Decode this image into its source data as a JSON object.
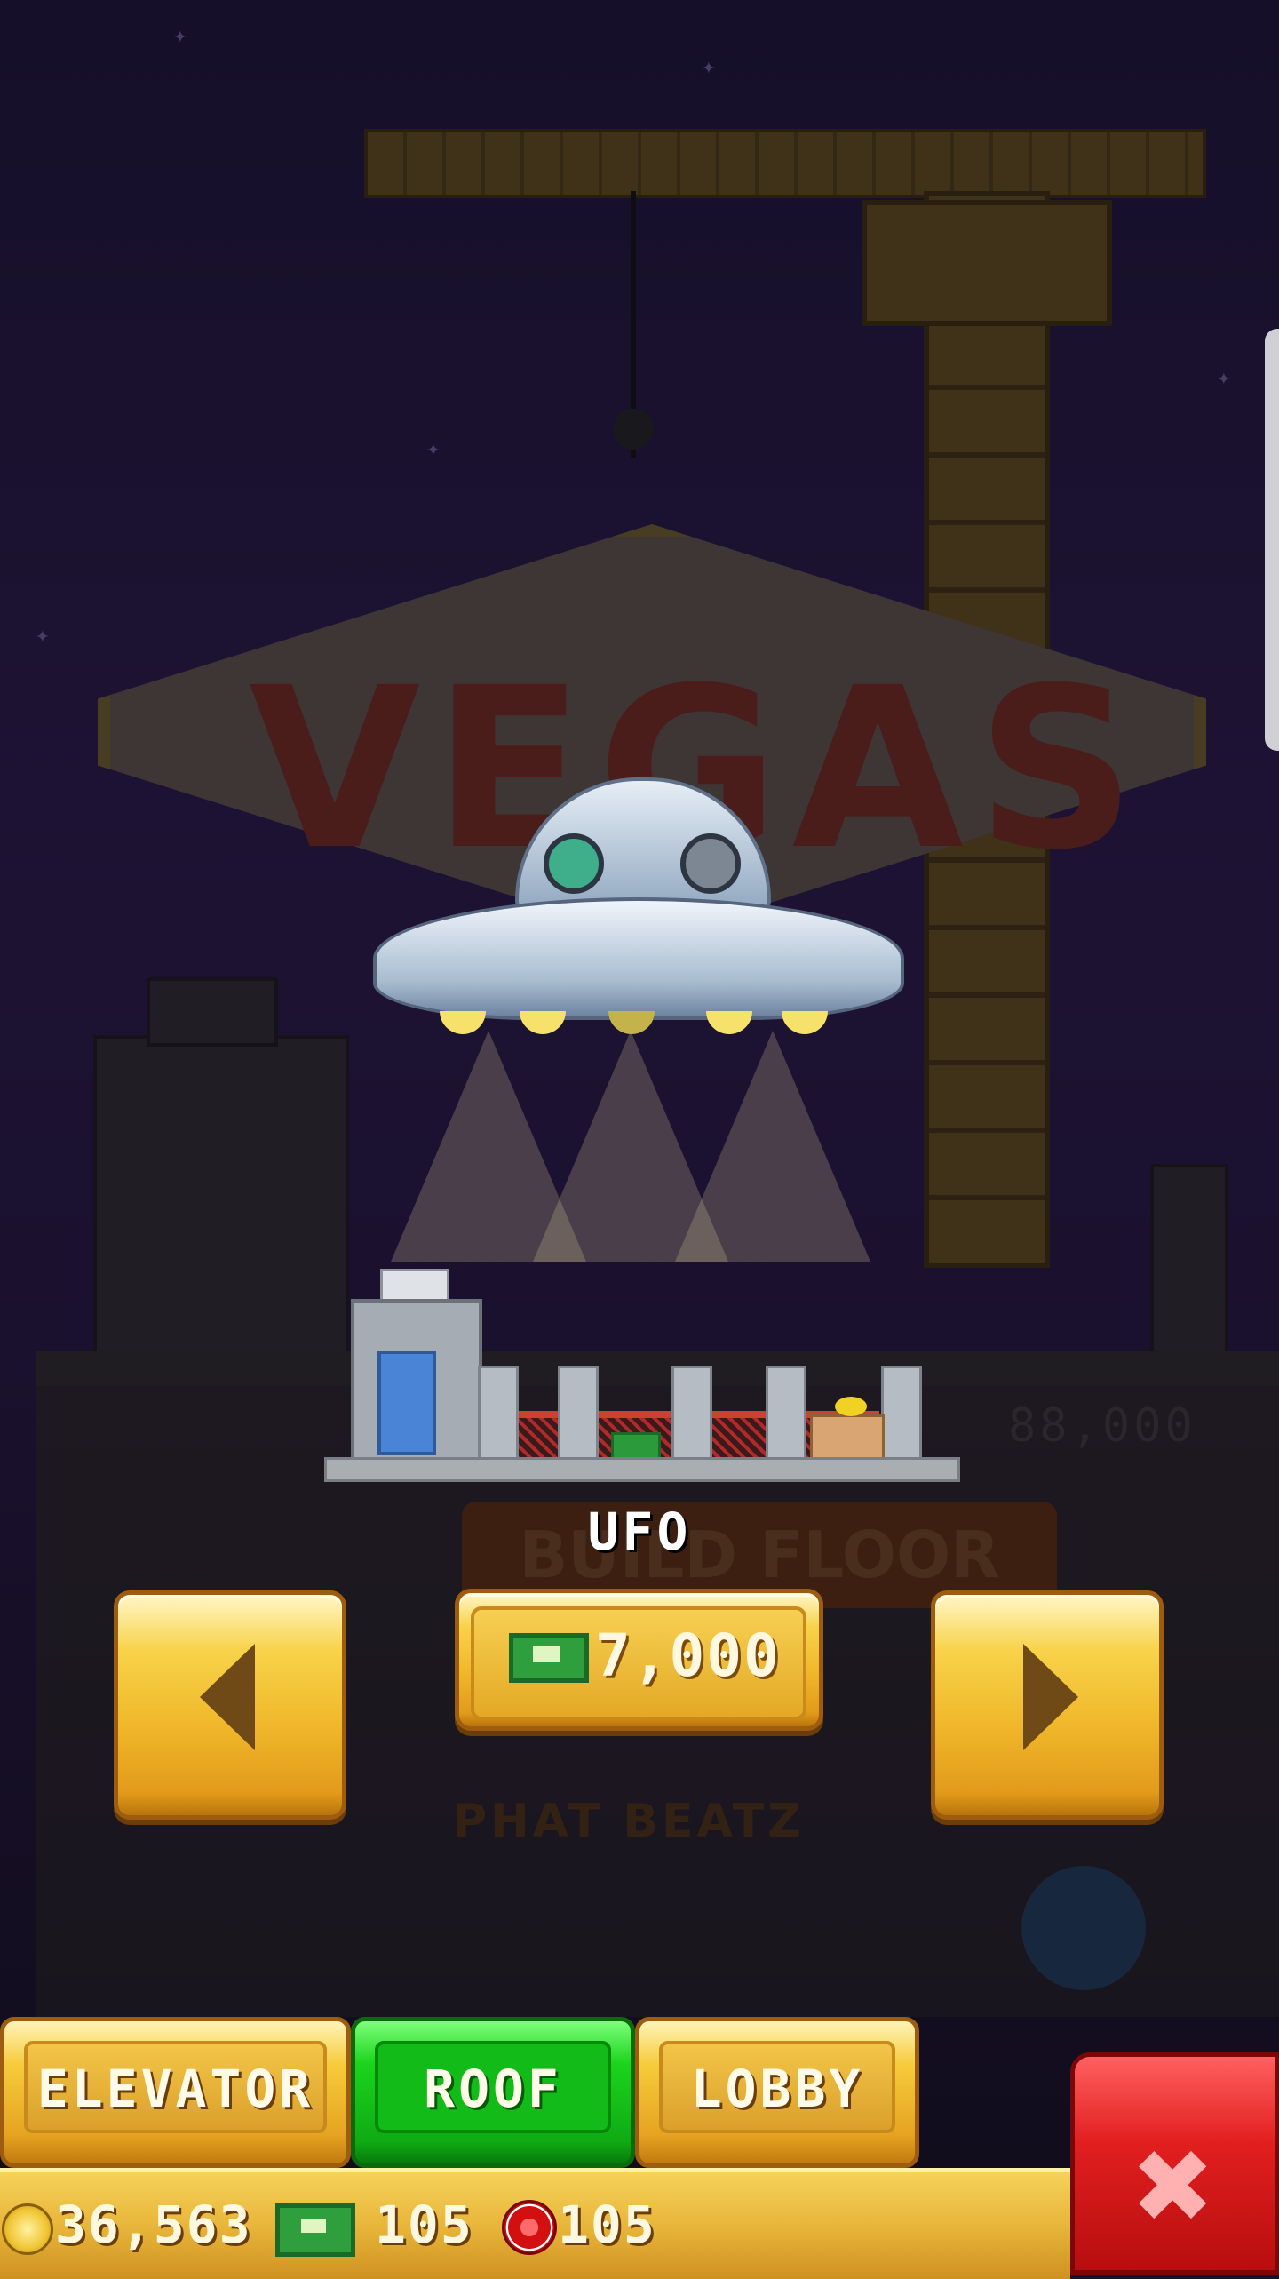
{
  "scene": {
    "sign_text": "VEGAS",
    "background_counter": "88,000",
    "background_build_label": "BUILD FLOOR",
    "background_floor_name": "PHAT BEATZ"
  },
  "selector": {
    "item_name": "UFO",
    "price": "7,000",
    "price_icon": "bux-icon",
    "prev_icon": "arrow-left-icon",
    "next_icon": "arrow-right-icon"
  },
  "tabs": [
    {
      "label": "ELEVATOR",
      "active": false
    },
    {
      "label": "ROOF",
      "active": true
    },
    {
      "label": "LOBBY",
      "active": false
    }
  ],
  "currency": {
    "coins": "36,563",
    "bux": "105",
    "chips": "105"
  },
  "close": {
    "icon": "close-icon"
  },
  "colors": {
    "active_tab": "#12bb18",
    "gold_button": "#f0b72a",
    "close_button": "#e21f1f",
    "night_sky": "#1c1535"
  }
}
